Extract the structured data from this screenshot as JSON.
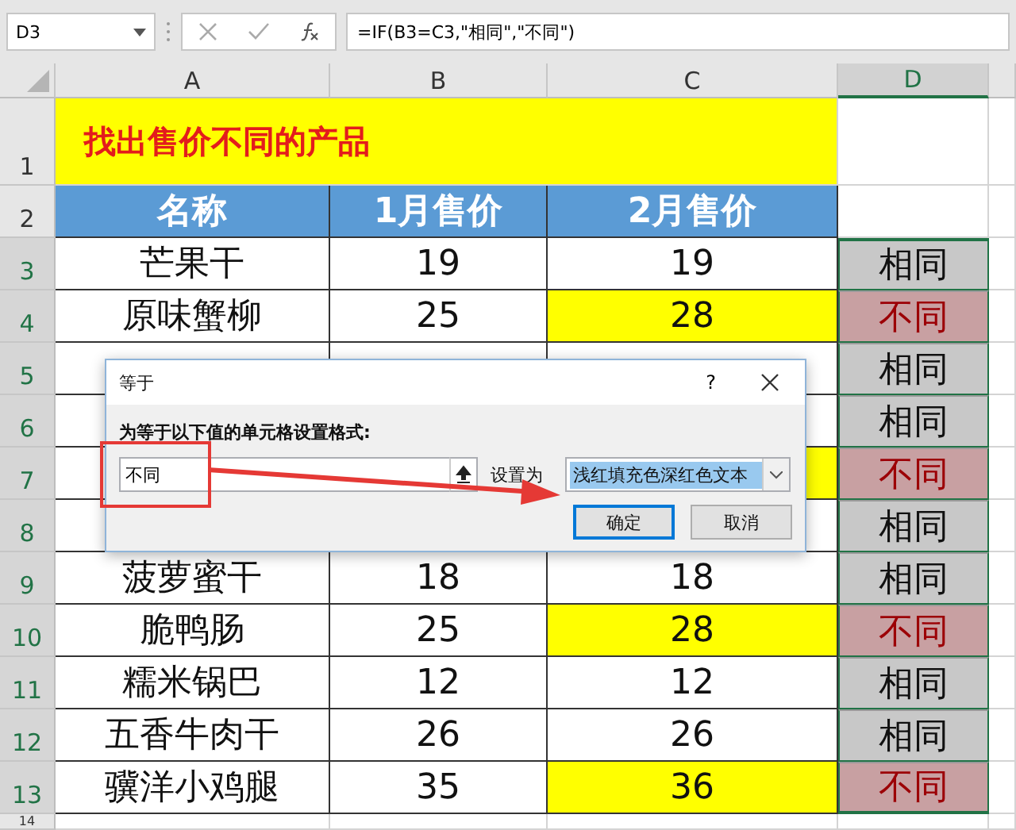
{
  "formula_bar": {
    "name_box": "D3",
    "formula": "=IF(B3=C3,\"相同\",\"不同\")"
  },
  "columns": [
    {
      "label": "A",
      "selected": false
    },
    {
      "label": "B",
      "selected": false
    },
    {
      "label": "C",
      "selected": false
    },
    {
      "label": "D",
      "selected": true
    }
  ],
  "title_row": {
    "number": "1",
    "selected": false,
    "text": "找出售价不同的产品"
  },
  "header_row": {
    "number": "2",
    "selected": false,
    "cells": [
      "名称",
      "1月售价",
      "2月售价"
    ]
  },
  "rows": [
    {
      "number": "3",
      "selected": true,
      "name": "芒果干",
      "jan": "19",
      "feb": "19",
      "highlight": false,
      "result": "相同",
      "kind": "same"
    },
    {
      "number": "4",
      "selected": true,
      "name": "原味蟹柳",
      "jan": "25",
      "feb": "28",
      "highlight": true,
      "result": "不同",
      "kind": "different"
    },
    {
      "number": "5",
      "selected": true,
      "highlight": false,
      "result": "相同",
      "kind": "same"
    },
    {
      "number": "6",
      "selected": true,
      "highlight": false,
      "result": "相同",
      "kind": "same"
    },
    {
      "number": "7",
      "selected": true,
      "highlight": true,
      "result": "不同",
      "kind": "different"
    },
    {
      "number": "8",
      "selected": true,
      "highlight": false,
      "result": "相同",
      "kind": "same"
    },
    {
      "number": "9",
      "selected": true,
      "name": "菠萝蜜干",
      "jan": "18",
      "feb": "18",
      "highlight": false,
      "result": "相同",
      "kind": "same"
    },
    {
      "number": "10",
      "selected": true,
      "name": "脆鸭肠",
      "jan": "25",
      "feb": "28",
      "highlight": true,
      "result": "不同",
      "kind": "different"
    },
    {
      "number": "11",
      "selected": true,
      "name": "糯米锅巴",
      "jan": "12",
      "feb": "12",
      "highlight": false,
      "result": "相同",
      "kind": "same"
    },
    {
      "number": "12",
      "selected": true,
      "name": "五香牛肉干",
      "jan": "26",
      "feb": "26",
      "highlight": false,
      "result": "相同",
      "kind": "same"
    },
    {
      "number": "13",
      "selected": true,
      "name": "骥洋小鸡腿",
      "jan": "35",
      "feb": "36",
      "highlight": true,
      "result": "不同",
      "kind": "different"
    }
  ],
  "last_row": {
    "number": "14"
  },
  "dialog": {
    "title": "等于",
    "help": "?",
    "instruction": "为等于以下值的单元格设置格式:",
    "value": "不同",
    "format_label": "设置为",
    "format": "浅红填充色深红色文本",
    "buttons": [
      {
        "label": "确定",
        "default": true
      },
      {
        "label": "取消",
        "default": false
      }
    ]
  }
}
